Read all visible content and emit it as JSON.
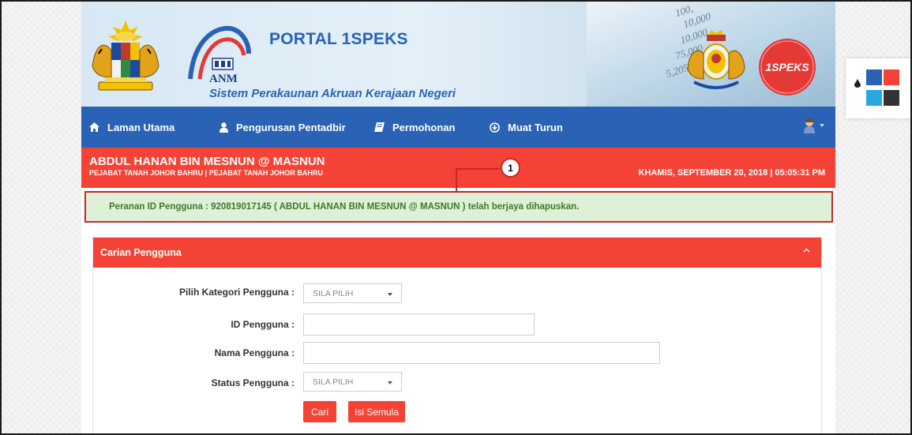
{
  "header": {
    "portal_title": "PORTAL 1SPEKS",
    "subtitle": "Sistem Perakaunan Akruan Kerajaan Negeri",
    "anm_label": "ANM",
    "speks_logo_text": "1SPEKS",
    "banner_numbers": [
      "100,",
      "10,000",
      "10,000",
      "75,000",
      "5,205"
    ]
  },
  "navbar": {
    "items": [
      {
        "label": "Laman Utama",
        "icon": "home-icon"
      },
      {
        "label": "Pengurusan Pentadbir",
        "icon": "user-icon"
      },
      {
        "label": "Permohonan",
        "icon": "book-icon"
      },
      {
        "label": "Muat Turun",
        "icon": "download-icon"
      }
    ],
    "user_icon": "user-avatar-icon"
  },
  "user_bar": {
    "name": "ABDUL HANAN BIN MESNUN @ MASNUN",
    "office": "PEJABAT TANAH JOHOR BAHRU | PEJABAT TANAH JOHOR BAHRU",
    "datetime": "KHAMIS, SEPTEMBER 20, 2018 | 05:05:31 PM"
  },
  "callout": {
    "number": "1"
  },
  "alert": {
    "message": "Peranan ID Pengguna : 920819017145 ( ABDUL HANAN BIN MESNUN @ MASNUN ) telah berjaya dihapuskan."
  },
  "panel": {
    "title": "Carian Pengguna",
    "fields": {
      "kategori_label": "Pilih Kategori Pengguna :",
      "kategori_value": "SILA PILIH",
      "id_label": "ID Pengguna :",
      "id_value": "",
      "nama_label": "Nama Pengguna :",
      "nama_value": "",
      "status_label": "Status Pengguna :",
      "status_value": "SILA PILIH"
    },
    "buttons": {
      "search": "Cari",
      "reset": "Isi Semula"
    }
  },
  "theme_widget": {
    "swatches": [
      "#2a63b5",
      "#f44336",
      "#29a8e0",
      "#333333"
    ]
  },
  "colors": {
    "primary_blue": "#2a63b5",
    "accent_red": "#f44336",
    "success_bg": "#dff0d8",
    "success_text": "#3d7a2a",
    "callout_red": "#c62828"
  }
}
